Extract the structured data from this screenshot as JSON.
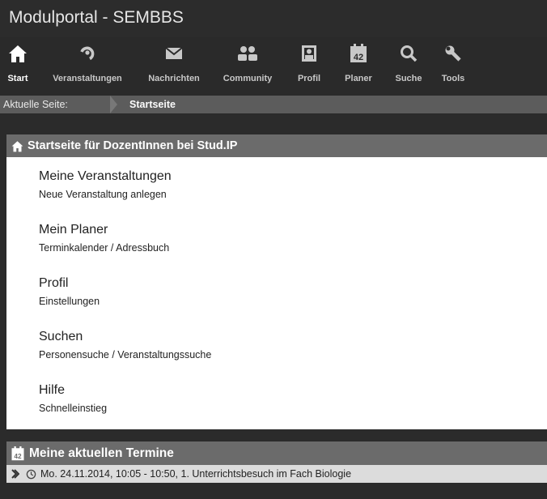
{
  "app": {
    "title": "Modulportal - SEMBBS"
  },
  "nav": {
    "items": [
      {
        "label": "Start",
        "icon": "home-icon",
        "active": true
      },
      {
        "label": "Veranstaltungen",
        "icon": "courses-icon"
      },
      {
        "label": "Nachrichten",
        "icon": "mail-icon"
      },
      {
        "label": "Community",
        "icon": "community-icon"
      },
      {
        "label": "Profil",
        "icon": "profile-icon"
      },
      {
        "label": "Planer",
        "icon": "calendar-icon"
      },
      {
        "label": "Suche",
        "icon": "search-icon"
      },
      {
        "label": "Tools",
        "icon": "wrench-icon"
      }
    ]
  },
  "breadcrumb": {
    "label": "Aktuelle Seite:",
    "current": "Startseite"
  },
  "start_panel": {
    "title": "Startseite für DozentInnen bei Stud.IP",
    "entries": [
      {
        "title": "Meine Veranstaltungen",
        "sub": "Neue Veranstaltung anlegen"
      },
      {
        "title": "Mein Planer",
        "sub": "Terminkalender / Adressbuch"
      },
      {
        "title": "Profil",
        "sub": "Einstellungen"
      },
      {
        "title": "Suchen",
        "sub": "Personensuche / Veranstaltungssuche"
      },
      {
        "title": "Hilfe",
        "sub": "Schnelleinstieg"
      }
    ]
  },
  "termine_panel": {
    "title": "Meine aktuellen Termine",
    "calendar_number": "42",
    "events": [
      {
        "text": "Mo. 24.11.2014, 10:05 - 10:50, 1. Unterrichtsbesuch im Fach Biologie"
      }
    ]
  },
  "colors": {
    "header_bg": "#2c2c2c",
    "panel_head": "#6b6b6b",
    "breadcrumb_bg": "#5c5c5c"
  }
}
